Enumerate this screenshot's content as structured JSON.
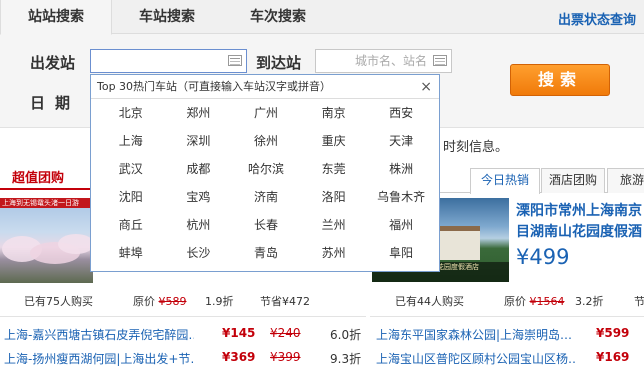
{
  "tabs": [
    "站站搜索",
    "车站搜索",
    "车次搜索"
  ],
  "right_link": "出票状态查询",
  "form": {
    "from_label": "出发站",
    "to_label": "到达站",
    "date_label": "日期",
    "from_value": "",
    "to_placeholder": "城市名、站名",
    "search_button": "搜索"
  },
  "hint_text": "时刻信息。",
  "popup": {
    "title": "Top 30热门车站（可直接输入车站汉字或拼音）",
    "close": "×",
    "cities": [
      "北京",
      "郑州",
      "广州",
      "南京",
      "西安",
      "上海",
      "深圳",
      "徐州",
      "重庆",
      "天津",
      "武汉",
      "成都",
      "哈尔滨",
      "东莞",
      "株洲",
      "沈阳",
      "宝鸡",
      "济南",
      "洛阳",
      "乌鲁木齐",
      "商丘",
      "杭州",
      "长春",
      "兰州",
      "福州",
      "蚌埠",
      "长沙",
      "青岛",
      "苏州",
      "阜阳"
    ]
  },
  "left": {
    "title": "超值团购",
    "image_band": "上海到无锡鼋头渚一日游",
    "bought": "已有75人购买",
    "orig_label": "原价",
    "orig_price": "¥589",
    "discount": "1.9折",
    "save": "节省¥472",
    "deals": [
      {
        "name": "上海-嘉兴西塘古镇石皮弄倪宅醉园…",
        "price": "¥145",
        "orig": "¥240",
        "discount": "6.0折"
      },
      {
        "name": "上海-扬州瘦西湖何园|上海出发+节…",
        "price": "¥369",
        "orig": "¥399",
        "discount": "9.3折"
      }
    ]
  },
  "right": {
    "tabs": [
      "今日热销",
      "酒店团购",
      "旅游"
    ],
    "title_line1": "溧阳市常州上海南京",
    "title_line2": "目湖南山花园度假酒",
    "price": "¥499",
    "image_caption": "天目湖南山花园度假酒店",
    "bought": "已有44人购买",
    "orig_label": "原价",
    "orig_price": "¥1564",
    "discount": "3.2折",
    "save": "节",
    "deals": [
      {
        "name": "上海东平国家森林公园|上海崇明岛…",
        "price": "¥599"
      },
      {
        "name": "上海宝山区普陀区顾村公园宝山区杨…",
        "price": "¥169"
      }
    ]
  }
}
